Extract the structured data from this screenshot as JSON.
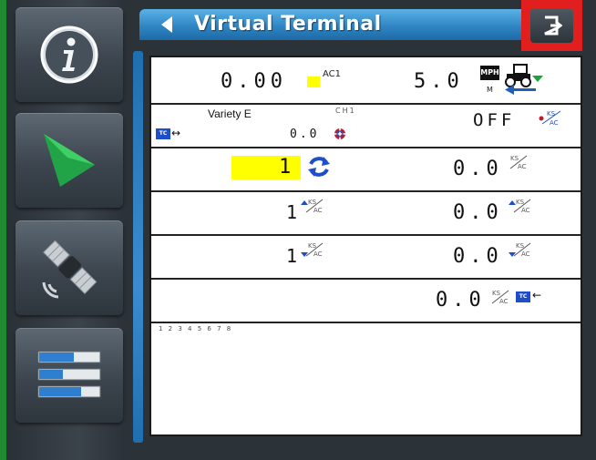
{
  "header": {
    "title": "Virtual Terminal"
  },
  "sidebar": {
    "items": [
      {
        "name": "info-icon"
      },
      {
        "name": "play-icon"
      },
      {
        "name": "satellite-icon"
      },
      {
        "name": "bar-list-icon"
      }
    ]
  },
  "terminal": {
    "row1": {
      "value": "0.00",
      "label": "AC1",
      "speed": "5.0",
      "unit_top": "MPH",
      "unit_bottom": "M"
    },
    "row2": {
      "name": "Variety E",
      "channel": "CH1",
      "value": "0.0",
      "status": "OFF"
    },
    "row3": {
      "value_left": "1",
      "value_right": "0.0",
      "unit": "KS/AC"
    },
    "row4": {
      "value_left": "1",
      "value_right": "0.0",
      "unit": "KS/AC"
    },
    "row5": {
      "value_left": "1",
      "value_right": "0.0",
      "unit": "KS/AC"
    },
    "row6": {
      "value_right": "0.0",
      "unit": "KS/AC",
      "tc_label": "TC"
    },
    "tc_label": "TC",
    "ruler": "1 2 3 4 5 6 7 8"
  },
  "colors": {
    "accent": "#2f86c4",
    "exit_highlight": "#e11f1f",
    "value_highlight": "#ffff00",
    "stripe": "#1f8a2f"
  }
}
